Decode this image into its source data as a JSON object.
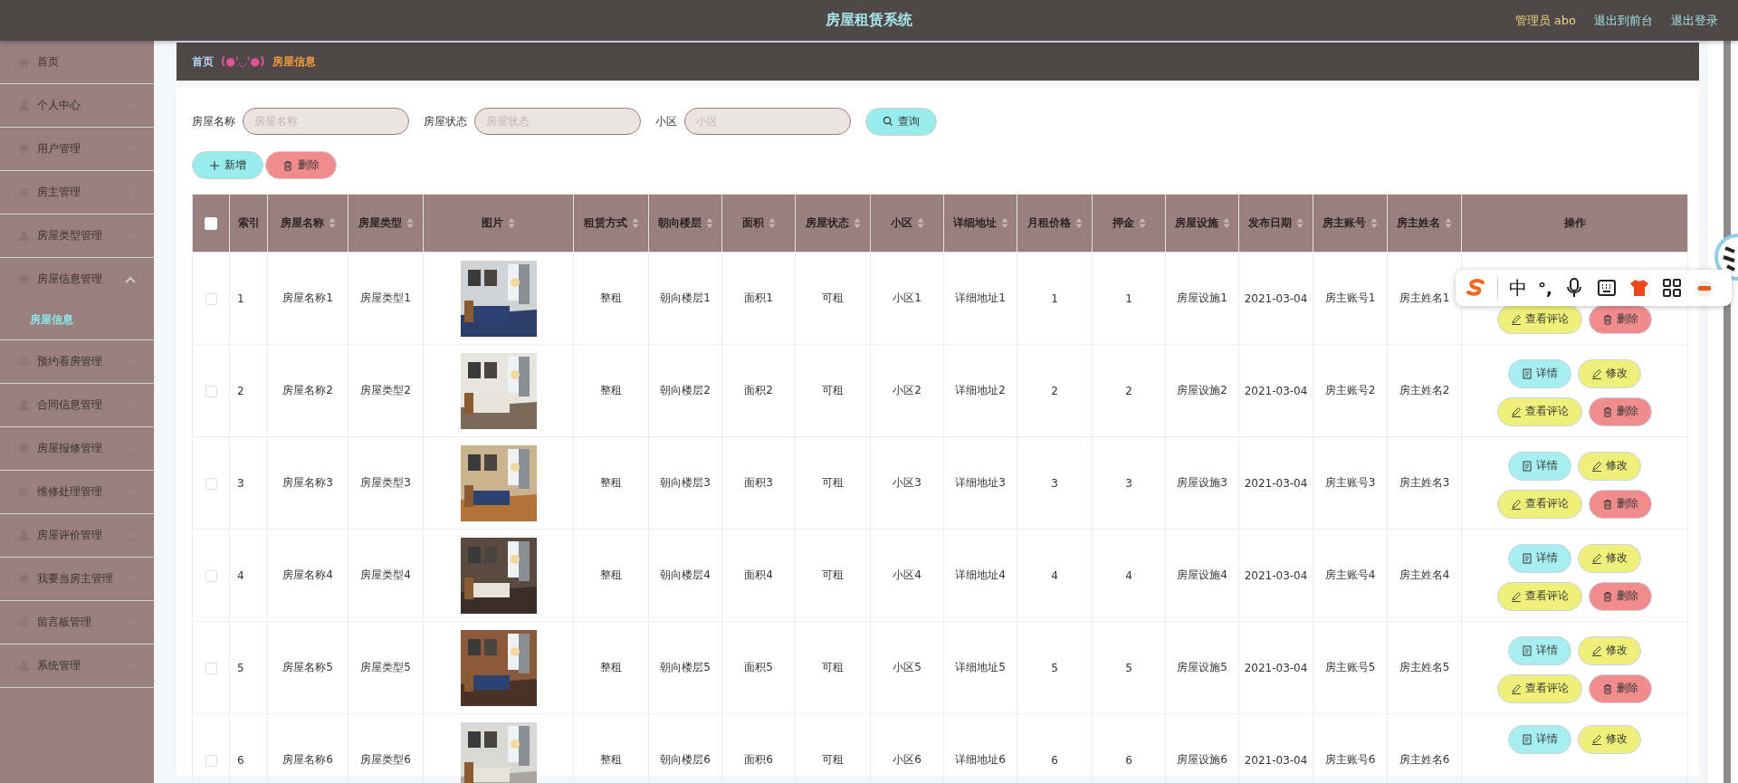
{
  "header": {
    "title": "房屋租赁系统",
    "user": "管理员 abo",
    "links": [
      "退出到前台",
      "退出登录"
    ]
  },
  "sidebar": {
    "items": [
      {
        "label": "首页",
        "kind": "link",
        "expanded": false
      },
      {
        "label": "个人中心",
        "kind": "menu",
        "expanded": false
      },
      {
        "label": "用户管理",
        "kind": "menu",
        "expanded": false
      },
      {
        "label": "房主管理",
        "kind": "menu",
        "expanded": false
      },
      {
        "label": "房屋类型管理",
        "kind": "menu",
        "expanded": false
      },
      {
        "label": "房屋信息管理",
        "kind": "menu",
        "expanded": true,
        "children": [
          {
            "label": "房屋信息",
            "selected": true
          }
        ]
      },
      {
        "label": "预约看房管理",
        "kind": "menu",
        "expanded": false
      },
      {
        "label": "合同信息管理",
        "kind": "menu",
        "expanded": false
      },
      {
        "label": "房屋报修管理",
        "kind": "menu",
        "expanded": false
      },
      {
        "label": "维修处理管理",
        "kind": "menu",
        "expanded": false
      },
      {
        "label": "房屋评价管理",
        "kind": "menu",
        "expanded": false
      },
      {
        "label": "我要当房主管理",
        "kind": "menu",
        "expanded": false
      },
      {
        "label": "留言板管理",
        "kind": "menu",
        "expanded": false
      },
      {
        "label": "系统管理",
        "kind": "menu",
        "expanded": false
      }
    ]
  },
  "breadcrumb": {
    "home": "首页",
    "separator": "(●'◡'●)",
    "current": "房屋信息"
  },
  "search": {
    "fields": [
      {
        "label": "房屋名称",
        "placeholder": "房屋名称"
      },
      {
        "label": "房屋状态",
        "placeholder": "房屋状态"
      },
      {
        "label": "小区",
        "placeholder": "小区"
      }
    ],
    "button": "查询"
  },
  "toolbar": [
    {
      "label": "新增",
      "kind": "add"
    },
    {
      "label": "删除",
      "kind": "delete"
    }
  ],
  "table": {
    "select_all": {
      "checked": false
    },
    "columns": [
      {
        "label": "索引",
        "sortable": false,
        "kind": "text"
      },
      {
        "label": "房屋名称",
        "sortable": true,
        "kind": "text"
      },
      {
        "label": "房屋类型",
        "sortable": true,
        "kind": "text"
      },
      {
        "label": "图片",
        "sortable": true,
        "kind": "picture"
      },
      {
        "label": "租赁方式",
        "sortable": true,
        "kind": "text"
      },
      {
        "label": "朝向楼层",
        "sortable": true,
        "kind": "text"
      },
      {
        "label": "面积",
        "sortable": true,
        "kind": "text"
      },
      {
        "label": "房屋状态",
        "sortable": true,
        "kind": "text"
      },
      {
        "label": "小区",
        "sortable": true,
        "kind": "text"
      },
      {
        "label": "详细地址",
        "sortable": true,
        "kind": "text"
      },
      {
        "label": "月租价格",
        "sortable": true,
        "kind": "text"
      },
      {
        "label": "押金",
        "sortable": true,
        "kind": "text"
      },
      {
        "label": "房屋设施",
        "sortable": true,
        "kind": "text"
      },
      {
        "label": "发布日期",
        "sortable": true,
        "kind": "text"
      },
      {
        "label": "房主账号",
        "sortable": true,
        "kind": "text"
      },
      {
        "label": "房主姓名",
        "sortable": true,
        "kind": "text"
      },
      {
        "label": "操作",
        "sortable": false,
        "kind": "actions"
      }
    ],
    "rows": [
      {
        "checked": false,
        "cells": [
          "1",
          "房屋名称1",
          "房屋类型1",
          {
            "kind": "picture"
          },
          "整租",
          "朝向楼层1",
          "面积1",
          "可租",
          "小区1",
          "详细地址1",
          "1",
          "1",
          "房屋设施1",
          "2021-03-04",
          "房主账号1",
          "房主姓名1"
        ],
        "actions": [
          {
            "label": "查看评论",
            "kind": "comment"
          },
          {
            "label": "删除",
            "kind": "delete"
          }
        ]
      },
      {
        "checked": false,
        "cells": [
          "2",
          "房屋名称2",
          "房屋类型2",
          {
            "kind": "picture"
          },
          "整租",
          "朝向楼层2",
          "面积2",
          "可租",
          "小区2",
          "详细地址2",
          "2",
          "2",
          "房屋设施2",
          "2021-03-04",
          "房主账号2",
          "房主姓名2"
        ],
        "actions": [
          {
            "label": "详情",
            "kind": "detail"
          },
          {
            "label": "修改",
            "kind": "edit"
          },
          {
            "label": "查看评论",
            "kind": "comment"
          },
          {
            "label": "删除",
            "kind": "delete"
          }
        ]
      },
      {
        "checked": false,
        "cells": [
          "3",
          "房屋名称3",
          "房屋类型3",
          {
            "kind": "picture"
          },
          "整租",
          "朝向楼层3",
          "面积3",
          "可租",
          "小区3",
          "详细地址3",
          "3",
          "3",
          "房屋设施3",
          "2021-03-04",
          "房主账号3",
          "房主姓名3"
        ],
        "actions": [
          {
            "label": "详情",
            "kind": "detail"
          },
          {
            "label": "修改",
            "kind": "edit"
          },
          {
            "label": "查看评论",
            "kind": "comment"
          },
          {
            "label": "删除",
            "kind": "delete"
          }
        ]
      },
      {
        "checked": false,
        "cells": [
          "4",
          "房屋名称4",
          "房屋类型4",
          {
            "kind": "picture"
          },
          "整租",
          "朝向楼层4",
          "面积4",
          "可租",
          "小区4",
          "详细地址4",
          "4",
          "4",
          "房屋设施4",
          "2021-03-04",
          "房主账号4",
          "房主姓名4"
        ],
        "actions": [
          {
            "label": "详情",
            "kind": "detail"
          },
          {
            "label": "修改",
            "kind": "edit"
          },
          {
            "label": "查看评论",
            "kind": "comment"
          },
          {
            "label": "删除",
            "kind": "delete"
          }
        ]
      },
      {
        "checked": false,
        "cells": [
          "5",
          "房屋名称5",
          "房屋类型5",
          {
            "kind": "picture"
          },
          "整租",
          "朝向楼层5",
          "面积5",
          "可租",
          "小区5",
          "详细地址5",
          "5",
          "5",
          "房屋设施5",
          "2021-03-04",
          "房主账号5",
          "房主姓名5"
        ],
        "actions": [
          {
            "label": "详情",
            "kind": "detail"
          },
          {
            "label": "修改",
            "kind": "edit"
          },
          {
            "label": "查看评论",
            "kind": "comment"
          },
          {
            "label": "删除",
            "kind": "delete"
          }
        ]
      },
      {
        "checked": false,
        "cells": [
          "6",
          "房屋名称6",
          "房屋类型6",
          {
            "kind": "picture"
          },
          "整租",
          "朝向楼层6",
          "面积6",
          "可租",
          "小区6",
          "详细地址6",
          "6",
          "6",
          "房屋设施6",
          "2021-03-04",
          "房主账号6",
          "房主姓名6"
        ],
        "actions": [
          {
            "label": "详情",
            "kind": "detail"
          },
          {
            "label": "修改",
            "kind": "edit"
          }
        ]
      }
    ]
  },
  "ime_toolbar": {
    "mode": "中",
    "punctuation": "°,"
  }
}
